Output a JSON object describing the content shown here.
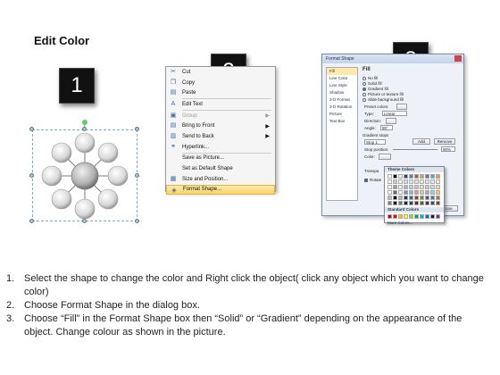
{
  "title": "Edit Color",
  "steps": [
    "1",
    "2",
    "3"
  ],
  "context_menu": {
    "items": [
      {
        "label": "Cut",
        "icon": "scissors-icon",
        "glyph": "✂",
        "disabled": false,
        "submenu": false
      },
      {
        "label": "Copy",
        "icon": "copy-icon",
        "glyph": "❐",
        "disabled": false,
        "submenu": false
      },
      {
        "label": "Paste",
        "icon": "paste-icon",
        "glyph": "📋",
        "disabled": false,
        "submenu": false
      },
      {
        "label": "Edit Text",
        "icon": "edit-text-icon",
        "glyph": "A",
        "disabled": false,
        "submenu": false
      },
      {
        "label": "Group",
        "icon": "group-icon",
        "glyph": "▣",
        "disabled": true,
        "submenu": true
      },
      {
        "label": "Bring to Front",
        "icon": "bring-front-icon",
        "glyph": "▤",
        "disabled": false,
        "submenu": true
      },
      {
        "label": "Send to Back",
        "icon": "send-back-icon",
        "glyph": "▥",
        "disabled": false,
        "submenu": true
      },
      {
        "label": "Hyperlink...",
        "icon": "hyperlink-icon",
        "glyph": "🔗",
        "disabled": false,
        "submenu": false
      },
      {
        "label": "Save as Picture...",
        "icon": "",
        "glyph": "",
        "disabled": false,
        "submenu": false
      },
      {
        "label": "Set as Default Shape",
        "icon": "",
        "glyph": "",
        "disabled": false,
        "submenu": false
      },
      {
        "label": "Size and Position...",
        "icon": "size-icon",
        "glyph": "▦",
        "disabled": false,
        "submenu": false
      },
      {
        "label": "Format Shape...",
        "icon": "format-shape-icon",
        "glyph": "◈",
        "disabled": false,
        "submenu": false,
        "highlighted": true
      }
    ]
  },
  "format_dialog": {
    "title": "Format Shape",
    "side_items": [
      "Fill",
      "Line Color",
      "Line Style",
      "Shadow",
      "3-D Format",
      "3-D Rotation",
      "Picture",
      "Text Box"
    ],
    "section": "Fill",
    "fill_options": [
      "No fill",
      "Solid fill",
      "Gradient fill",
      "Picture or texture fill",
      "Slide background fill"
    ],
    "selected_fill": 2,
    "labels": {
      "preset": "Preset colors:",
      "type": "Type:",
      "type_value": "Linear",
      "direction": "Direction:",
      "angle": "Angle:",
      "angle_value": "90°",
      "gradient_stops": "Gradient stops",
      "stop_value": "Stop 1",
      "add": "Add",
      "remove": "Remove",
      "stop_position": "Stop position:",
      "stop_position_value": "90%",
      "color": "Color:",
      "transparency": "Transpa",
      "rotate": "Rotate",
      "close": "Close"
    }
  },
  "color_picker": {
    "theme_header": "Theme Colors",
    "standard_header": "Standard Colors",
    "more": "More Colors...",
    "theme_colors": [
      "#ffffff",
      "#000000",
      "#eeece1",
      "#1f497d",
      "#4f81bd",
      "#c0504d",
      "#9bbb59",
      "#8064a2",
      "#4bacc6",
      "#f79646"
    ],
    "standard_colors": [
      "#c00000",
      "#ff0000",
      "#ffc000",
      "#ffff00",
      "#92d050",
      "#00b050",
      "#00b0f0",
      "#0070c0",
      "#002060",
      "#7030a0"
    ]
  },
  "instructions": [
    {
      "num": "1.",
      "text": "Select the shape to change the color and Right click the object( click any object which you want to change color)"
    },
    {
      "num": "2.",
      "text": "Choose Format Shape in the dialog box."
    },
    {
      "num": "3.",
      "text": "Choose “Fill” in the Format Shape box then “Solid” or “Gradient” depending on the appearance of the object. Change colour as shown in the picture."
    }
  ]
}
